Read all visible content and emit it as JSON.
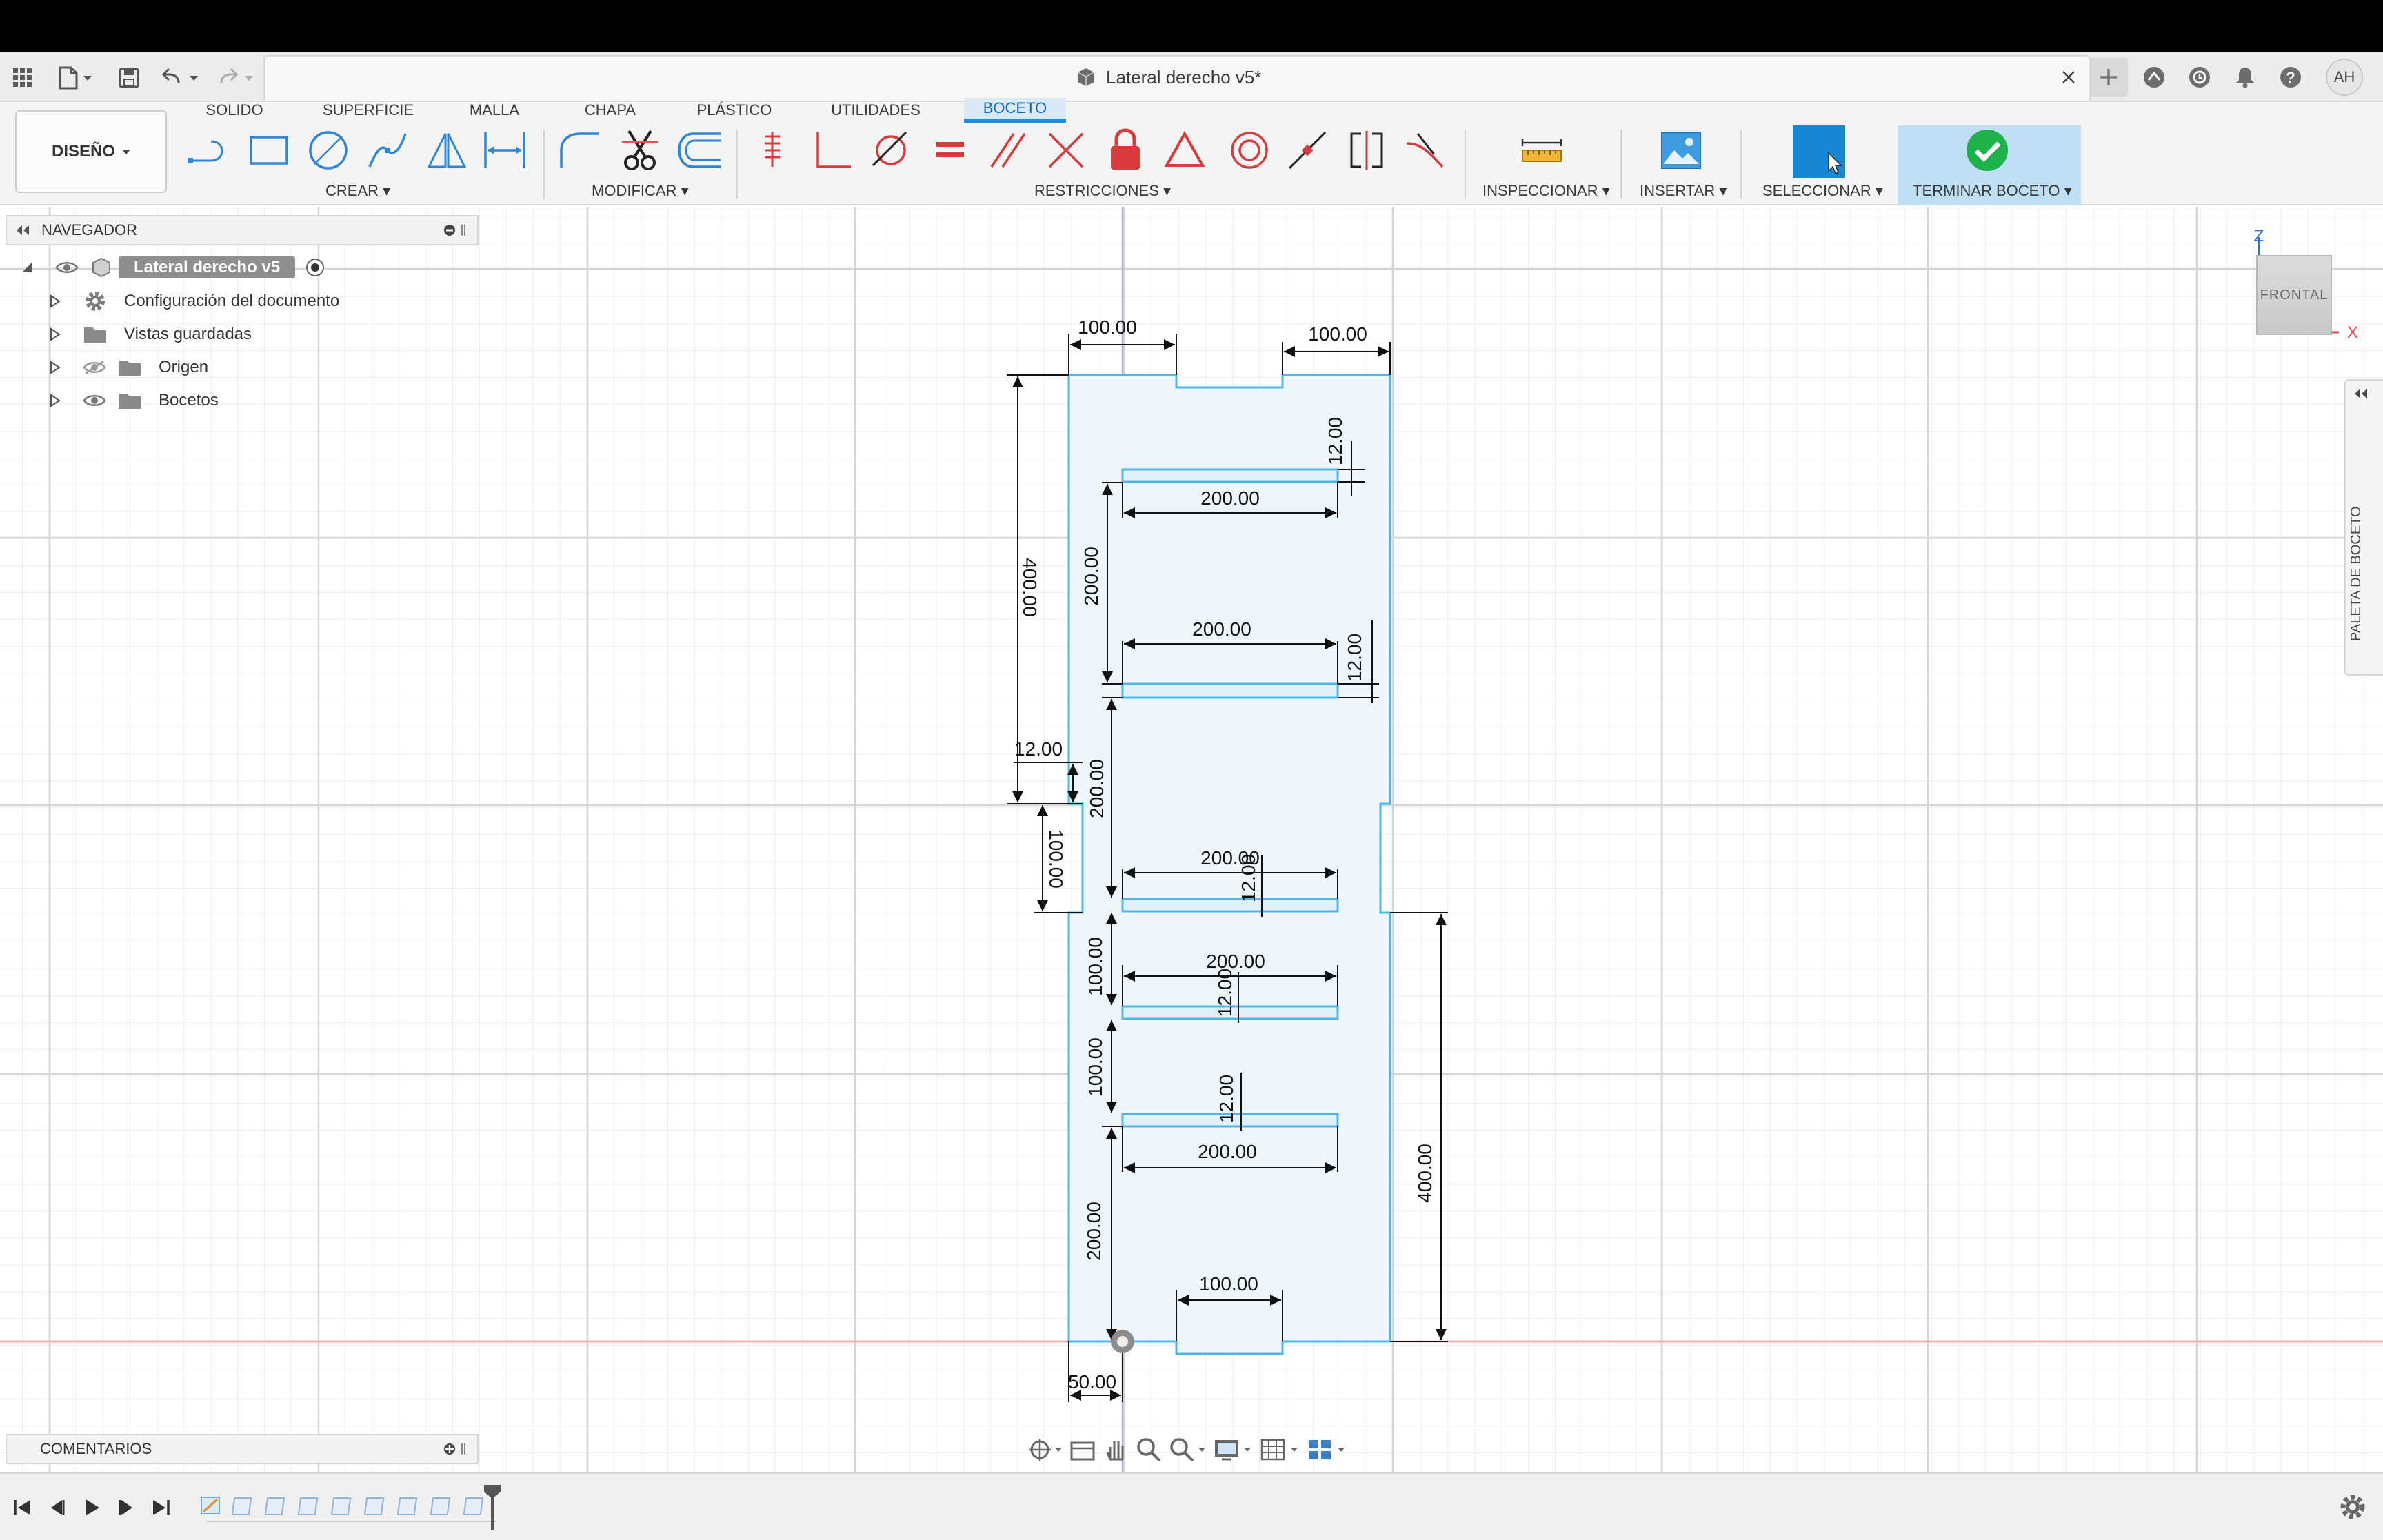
{
  "document": {
    "title": "Lateral derecho v5*",
    "user_initials": "AH"
  },
  "ribbon": {
    "workspace": "DISEÑO",
    "tabs": [
      {
        "label": "SOLIDO",
        "active": false
      },
      {
        "label": "SUPERFICIE",
        "active": false
      },
      {
        "label": "MALLA",
        "active": false
      },
      {
        "label": "CHAPA",
        "active": false
      },
      {
        "label": "PLÁSTICO",
        "active": false
      },
      {
        "label": "UTILIDADES",
        "active": false
      },
      {
        "label": "BOCETO",
        "active": true
      }
    ],
    "groups": {
      "crear": "CREAR",
      "modificar": "MODIFICAR",
      "restricciones": "RESTRICCIONES",
      "inspeccionar": "INSPECCIONAR",
      "insertar": "INSERTAR",
      "seleccionar": "SELECCIONAR",
      "terminar": "TERMINAR BOCETO"
    },
    "accent_color": "#1d8fe0"
  },
  "browser": {
    "title": "NAVEGADOR",
    "root": "Lateral derecho v5",
    "items": [
      {
        "label": "Configuración del documento",
        "icon": "gear-icon"
      },
      {
        "label": "Vistas guardadas",
        "icon": "folder-icon"
      },
      {
        "label": "Origen",
        "icon": "folder-icon",
        "visibility": "hidden"
      },
      {
        "label": "Bocetos",
        "icon": "folder-icon",
        "visibility": "visible"
      }
    ]
  },
  "comments": {
    "title": "COMENTARIOS"
  },
  "viewcube": {
    "face": "FRONTAL",
    "axis_z": "Z",
    "axis_x": "X"
  },
  "sketch_palette": {
    "label": "PALETA DE BOCETO"
  },
  "sketch": {
    "profile_color": "#4db8e8",
    "fill_color": "#eef6fb",
    "dimension_color": "#111111",
    "dimensions": {
      "top_left": "100.00",
      "top_right": "100.00",
      "top_slot_thickness": "12.00",
      "top_slot_width": "200.00",
      "left_height_upper": "400.00",
      "slot_spacing_1": "200.00",
      "second_slot_width": "200.00",
      "second_slot_thickness": "12.00",
      "left_notch_offset": "12.00",
      "slot_spacing_2": "200.00",
      "left_notch_height": "100.00",
      "third_slot_width": "200.00",
      "third_slot_thickness": "12.00",
      "fourth_slot_width": "200.00",
      "fourth_slot_thickness": "12.00",
      "slot_spacing_3": "100.00",
      "slot_spacing_4": "100.00",
      "fifth_slot_thickness": "12.00",
      "fifth_slot_width": "200.00",
      "right_height_lower": "400.00",
      "bottom_offset": "200.00",
      "bottom_notch_width": "100.00",
      "origin_offset": "50.00"
    }
  }
}
